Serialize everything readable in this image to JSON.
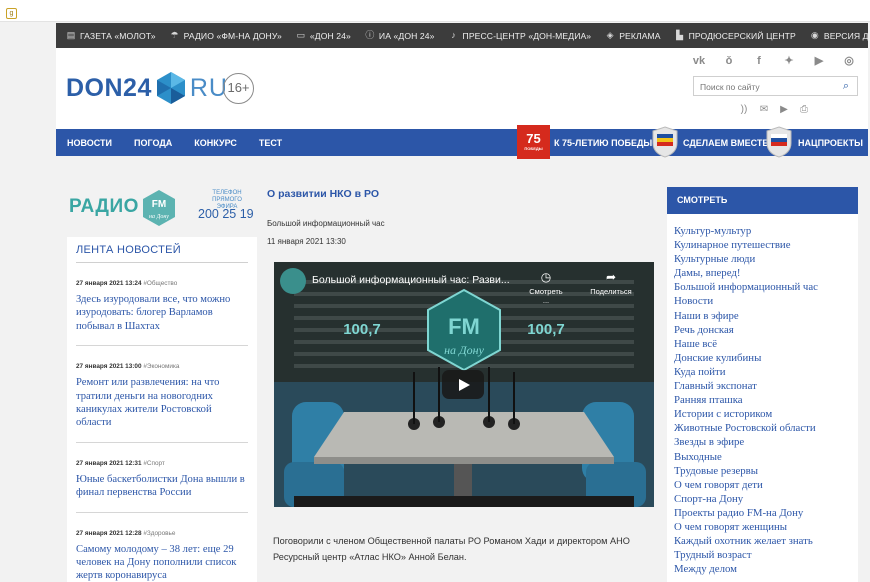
{
  "browser": {
    "tab_icon": "g"
  },
  "topbar": {
    "items": [
      {
        "icon": "newspaper-icon",
        "label": "ГАЗЕТА «МОЛОТ»"
      },
      {
        "icon": "radio-icon",
        "label": "РАДИО «ФМ-НА ДОНУ»"
      },
      {
        "icon": "tv-icon",
        "label": "«ДОН 24»"
      },
      {
        "icon": "info-icon",
        "label": "ИА «ДОН 24»"
      },
      {
        "icon": "microphone-icon",
        "label": "ПРЕСС-ЦЕНТР «ДОН-МЕДИА»"
      },
      {
        "icon": "target-icon",
        "label": "РЕКЛАМА"
      },
      {
        "icon": "building-icon",
        "label": "ПРОДЮСЕРСКИЙ ЦЕНТР"
      }
    ],
    "accessibility": "ВЕРСИЯ ДЛЯ СЛАБОВИДЯЩИХ"
  },
  "header": {
    "logo_left": "DON24",
    "logo_right": "RU",
    "age": "16+",
    "search_placeholder": "Поиск по сайту"
  },
  "nav": {
    "items": [
      "НОВОСТИ",
      "ПОГОДА",
      "КОНКУРС",
      "ТЕСТ"
    ],
    "victory_badge": "75",
    "victory_sub": "ПОБЕДЫ",
    "victory": "К 75-ЛЕТИЮ ПОБЕДЫ",
    "together": "СДЕЛАЕМ ВМЕСТЕ",
    "projects": "НАЦПРОЕКТЫ"
  },
  "radio": {
    "word": "РАДИО",
    "logo_top": "FM",
    "logo_bottom": "на Дону",
    "caption": "ТЕЛЕФОН ПРЯМОГО ЭФИРА",
    "phone": "200 25 19"
  },
  "feed": {
    "title": "ЛЕНТА НОВОСТЕЙ",
    "items": [
      {
        "date": "27 января 2021 13:24",
        "cat": "#Общество",
        "text": "Здесь изуродовали все, что можно изуродовать: блогер Варламов побывал в Шахтах"
      },
      {
        "date": "27 января 2021 13:00",
        "cat": "#Экономика",
        "text": "Ремонт или развлечения: на что тратили деньги на новогодних каникулах жители Ростовской области"
      },
      {
        "date": "27 января 2021 12:31",
        "cat": "#Спорт",
        "text": "Юные баскетболистки Дона вышли в финал первенства России"
      },
      {
        "date": "27 января 2021 12:28",
        "cat": "#Здоровье",
        "text": "Самому молодому – 38 лет: еще 29 человек на Дону пополнили список жертв коронавируса"
      }
    ]
  },
  "article": {
    "title": "О развитии НКО в РО",
    "subtitle": "Большой информационный час",
    "date": "11 января 2021 13:30",
    "video_title": "Большой информационный час: Разви...",
    "watch_later": "Смотреть ...",
    "share": "Поделиться",
    "freq": "100,7",
    "body": "Поговорили с членом Общественной палаты РО Романом Хади  и директором АНО Ресурсный центр «Атлас НКО» Анной Белан."
  },
  "aside": {
    "title": "СМОТРЕТЬ",
    "items": [
      "Культур-мультур",
      "Кулинарное путешествие",
      "Культурные люди",
      "Дамы, вперед!",
      "Большой информационный час",
      "Новости",
      "Наши в эфире",
      "Речь донская",
      "Наше всё",
      "Донские кулибины",
      "Куда пойти",
      "Главный экспонат",
      "Ранняя пташка",
      "Истории с историком",
      "Животные Ростовской области",
      "Звезды в эфире",
      "Выходные",
      "Трудовые резервы",
      "О чем говорят дети",
      "Спорт-на Дону",
      "Проекты радио FM-на Дону",
      "О чем говорят женщины",
      "Каждый охотник желает знать",
      "Трудный возраст",
      "Между делом"
    ]
  },
  "colors": {
    "brand_blue": "#2c56a8",
    "topbar": "#3c3c3c",
    "teal": "#3aa6a3",
    "victory_red": "#d52a1d"
  }
}
